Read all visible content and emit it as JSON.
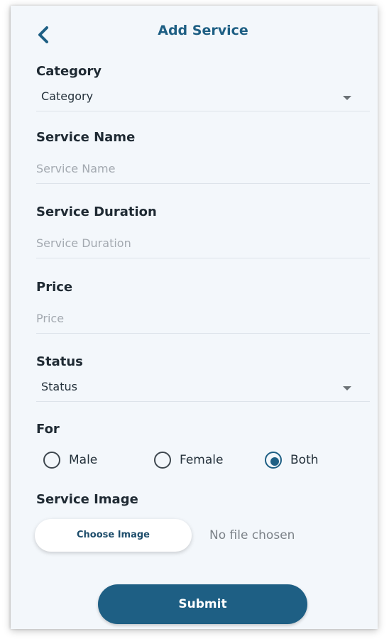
{
  "header": {
    "title": "Add Service"
  },
  "form": {
    "category": {
      "label": "Category",
      "value": "Category"
    },
    "service_name": {
      "label": "Service Name",
      "placeholder": "Service Name"
    },
    "service_duration": {
      "label": "Service Duration",
      "placeholder": "Service Duration"
    },
    "price": {
      "label": "Price",
      "placeholder": "Price"
    },
    "status": {
      "label": "Status",
      "value": "Status"
    },
    "for": {
      "label": "For",
      "options": [
        "Male",
        "Female",
        "Both"
      ],
      "selected": "Both"
    },
    "service_image": {
      "label": "Service Image",
      "button_label": "Choose Image",
      "file_status": "No file chosen"
    }
  },
  "submit_label": "Submit",
  "colors": {
    "accent": "#1e5f84",
    "background": "#f3f7fb"
  },
  "icons": {
    "back": "chevron-left-icon",
    "dropdown": "caret-down-icon"
  }
}
